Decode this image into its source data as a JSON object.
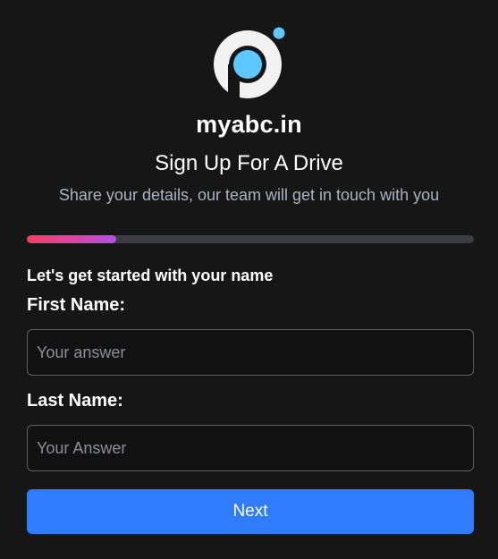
{
  "brand": {
    "name": "myabc.in",
    "logo_icon": "brand-logo-icon",
    "logo_colors": {
      "ring": "#f2f2f2",
      "inner": "#5cc8ff",
      "dot": "#5cc8ff"
    }
  },
  "header": {
    "title": "Sign Up For A Drive",
    "subtitle": "Share your details, our team will get in touch with you"
  },
  "progress": {
    "fraction": 0.2,
    "colors": [
      "#f43f5e",
      "#b94ee8"
    ],
    "track_color": "#3b3d45"
  },
  "form": {
    "step_heading": "Let's get started with your name",
    "first_name": {
      "label": "First Name:",
      "placeholder": "Your answer",
      "value": ""
    },
    "last_name": {
      "label": "Last Name:",
      "placeholder": "Your Answer",
      "value": ""
    },
    "next_label": "Next"
  },
  "colors": {
    "background": "#161616",
    "accent": "#2f7cff",
    "subtitle": "#aab3c5"
  }
}
